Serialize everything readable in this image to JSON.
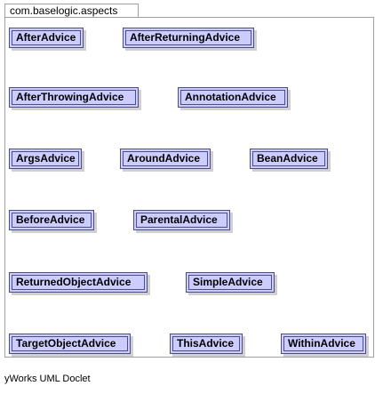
{
  "package": {
    "name": "com.baselogic.aspects"
  },
  "classes": [
    {
      "name": "AfterAdvice"
    },
    {
      "name": "AfterReturningAdvice"
    },
    {
      "name": "AfterThrowingAdvice"
    },
    {
      "name": "AnnotationAdvice"
    },
    {
      "name": "ArgsAdvice"
    },
    {
      "name": "AroundAdvice"
    },
    {
      "name": "BeanAdvice"
    },
    {
      "name": "BeforeAdvice"
    },
    {
      "name": "ParentalAdvice"
    },
    {
      "name": "ReturnedObjectAdvice"
    },
    {
      "name": "SimpleAdvice"
    },
    {
      "name": "TargetObjectAdvice"
    },
    {
      "name": "ThisAdvice"
    },
    {
      "name": "WithinAdvice"
    }
  ],
  "footer": {
    "text": "yWorks UML Doclet"
  },
  "colors": {
    "class_fill": "#ccccff",
    "class_border": "#4d4d80",
    "package_border": "#a0a0a0"
  }
}
